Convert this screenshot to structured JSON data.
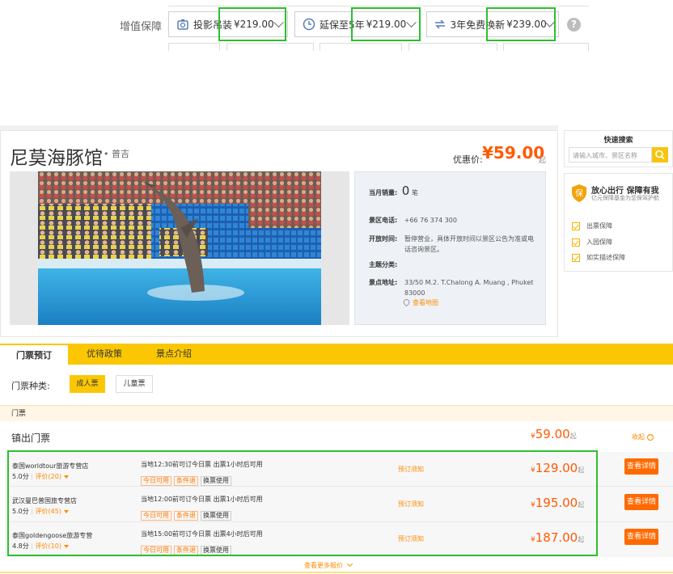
{
  "value_added": {
    "label": "增值保障",
    "items": [
      {
        "name": "投影吊装",
        "price": "¥219.00"
      },
      {
        "name": "延保至5年",
        "price": "¥219.00"
      },
      {
        "name": "3年免费换新",
        "price": "¥239.00"
      }
    ],
    "help": "?"
  },
  "attraction": {
    "title": "尼莫海豚馆",
    "city": "• 普吉",
    "price_label": "优惠价:",
    "price": "¥59.00",
    "price_suffix": "起"
  },
  "info": {
    "monthly_sales_label": "当月销量:",
    "monthly_sales_value": "0",
    "monthly_sales_unit": "笔",
    "phone_label": "景区电话:",
    "phone_value": "+66 76 374 300",
    "hours_label": "开放时间:",
    "hours_value": "暂停营业，具体开放时间以景区公告为准或电话咨询景区。",
    "theme_label": "主题分类:",
    "theme_value": "",
    "address_label": "景点地址:",
    "address_value": "33/50 M.2. T.Chalong A. Muang , Phuket 83000",
    "map_link": "查看地图"
  },
  "sidebar": {
    "quick_search_title": "快速搜索",
    "search_placeholder": "请输入城市、景区名称",
    "guarantee_title": "放心出行 保障有我",
    "guarantee_sub": "亿元保障基金为您保驾护航",
    "guarantee_items": [
      "出票保障",
      "入园保障",
      "如实描述保障"
    ]
  },
  "tabs": [
    "门票预订",
    "优待政策",
    "景点介绍"
  ],
  "ticket_types": {
    "label": "门票种类:",
    "options": [
      "成人票",
      "儿童票"
    ]
  },
  "section_header": "门票",
  "group": {
    "title": "镇出门票",
    "price_currency": "¥",
    "price": "59.00",
    "price_suffix": "起",
    "collapse": "收起"
  },
  "offers": [
    {
      "vendor": "泰国worldtour旅游专营店",
      "score": "5.0分",
      "reviews": "评价(20)",
      "desc": "当地12:30前可订今日票 出票1小时后可用",
      "tags": [
        "今日可用",
        "条件退",
        "换票使用"
      ],
      "notice": "预订须知",
      "price": "129.00",
      "button": "查看详情"
    },
    {
      "vendor": "武汉曼巴普国旅专营店",
      "score": "5.0分",
      "reviews": "评价(45)",
      "desc": "当地12:00前可订今日票 出票1小时后可用",
      "tags": [
        "今日可用",
        "条件退",
        "换票使用"
      ],
      "notice": "预订须知",
      "price": "195.00",
      "button": "查看详情"
    },
    {
      "vendor": "泰国goldengoose旅游专营",
      "score": "4.8分",
      "reviews": "评价(10)",
      "desc": "当地15:00前可订今日票 出票4小时后可用",
      "tags": [
        "今日可用",
        "条件退",
        "换票使用"
      ],
      "notice": "预订须知",
      "price": "187.00",
      "button": "查看详情"
    }
  ],
  "offer_currency": "¥",
  "offer_suffix": "起",
  "more_link": "查看更多报价"
}
